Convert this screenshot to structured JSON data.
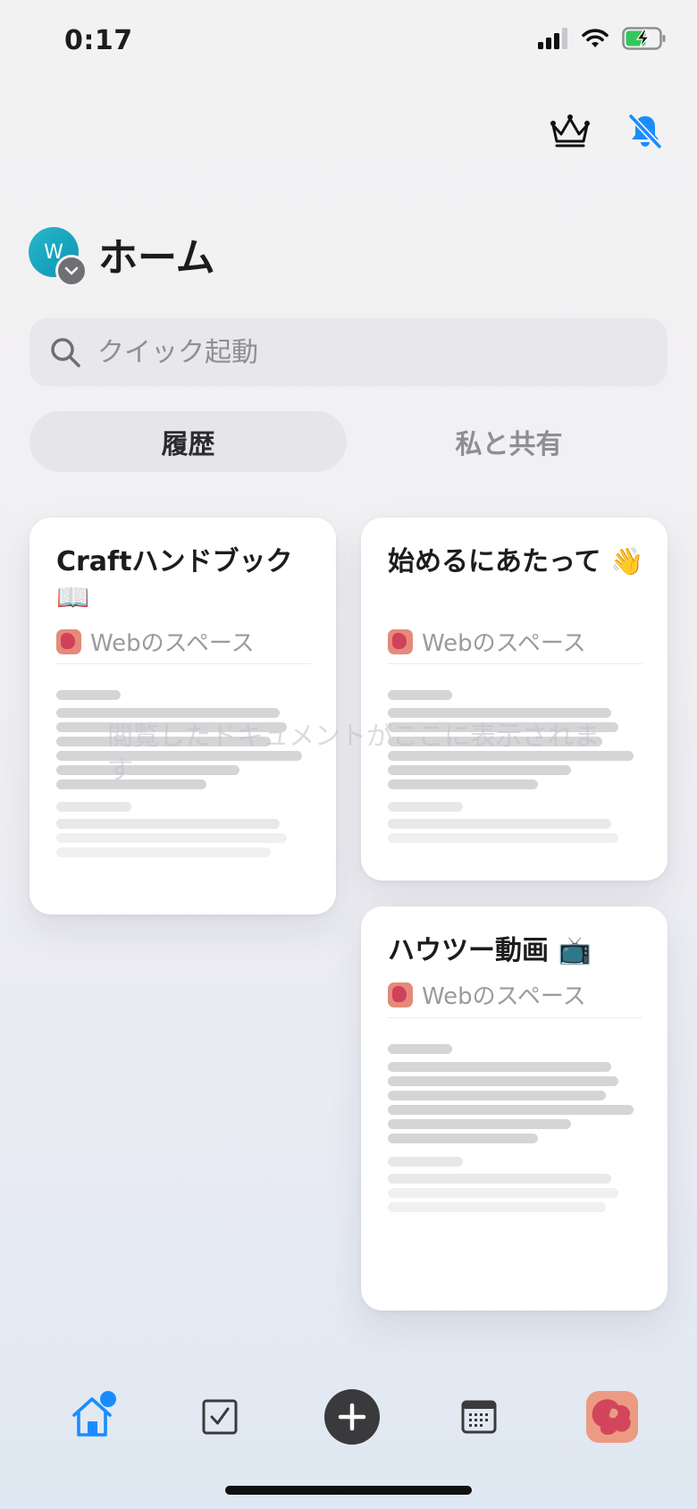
{
  "status_bar": {
    "time": "0:17"
  },
  "header": {
    "title": "ホーム",
    "avatar_letter": "W"
  },
  "search": {
    "placeholder": "クイック起動"
  },
  "segments": {
    "history": "履歴",
    "shared": "私と共有"
  },
  "cards": [
    {
      "title": "Craftハンドブック 📖",
      "space": "Webのスペース"
    },
    {
      "title": "始めるにあたって 👋",
      "space": "Webのスペース"
    },
    {
      "title": "ハウツー動画 📺",
      "space": "Webのスペース"
    }
  ],
  "overlay_message": "閲覧したドキュメントがここに表示されます",
  "colors": {
    "accent": "#1a8cff",
    "add_button": "#3a3a3c"
  },
  "icons": [
    "crown-icon",
    "notifications-off-icon",
    "search-icon",
    "home-icon",
    "tasks-icon",
    "add-icon",
    "calendar-icon",
    "space-avatar-icon"
  ]
}
